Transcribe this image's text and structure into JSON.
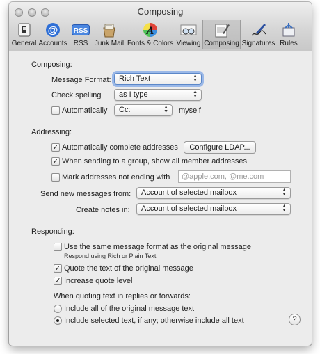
{
  "window": {
    "title": "Composing"
  },
  "toolbar": [
    {
      "label": "General",
      "icon": "general-switch-icon"
    },
    {
      "label": "Accounts",
      "icon": "at-sign-icon"
    },
    {
      "label": "RSS",
      "icon": "rss-icon"
    },
    {
      "label": "Junk Mail",
      "icon": "junk-mail-icon"
    },
    {
      "label": "Fonts & Colors",
      "icon": "fonts-colors-icon"
    },
    {
      "label": "Viewing",
      "icon": "glasses-icon"
    },
    {
      "label": "Composing",
      "icon": "composing-icon",
      "active": true
    },
    {
      "label": "Signatures",
      "icon": "signature-pen-icon"
    },
    {
      "label": "Rules",
      "icon": "rules-icon"
    }
  ],
  "composing": {
    "heading": "Composing:",
    "message_format_label": "Message Format:",
    "message_format_value": "Rich Text",
    "check_spelling_label": "Check spelling",
    "check_spelling_value": "as I type",
    "auto_label": "Automatically",
    "auto_checked": false,
    "auto_cc_value": "Cc:",
    "myself_label": "myself"
  },
  "addressing": {
    "heading": "Addressing:",
    "auto_complete_label": "Automatically complete addresses",
    "auto_complete_checked": true,
    "configure_ldap_label": "Configure LDAP...",
    "group_label": "When sending to a group, show all member addresses",
    "group_checked": true,
    "mark_label": "Mark addresses not ending with",
    "mark_checked": false,
    "mark_placeholder": "@apple.com, @me.com",
    "send_from_label": "Send new messages from:",
    "send_from_value": "Account of selected mailbox",
    "create_notes_label": "Create notes in:",
    "create_notes_value": "Account of selected mailbox"
  },
  "responding": {
    "heading": "Responding:",
    "same_format_label": "Use the same message format as the original message",
    "same_format_checked": false,
    "same_format_note": "Respond using Rich or Plain Text",
    "quote_label": "Quote the text of the original message",
    "quote_checked": true,
    "increase_label": "Increase quote level",
    "increase_checked": true,
    "when_quoting_label": "When quoting text in replies or forwards:",
    "include_all_label": "Include all of the original message text",
    "include_selected_label": "Include selected text, if any; otherwise include all text",
    "selected_option": "include_selected"
  },
  "help": {
    "label": "?"
  },
  "colors": {
    "window_bg": "#ececec",
    "focus_ring": "#5b87c8"
  }
}
